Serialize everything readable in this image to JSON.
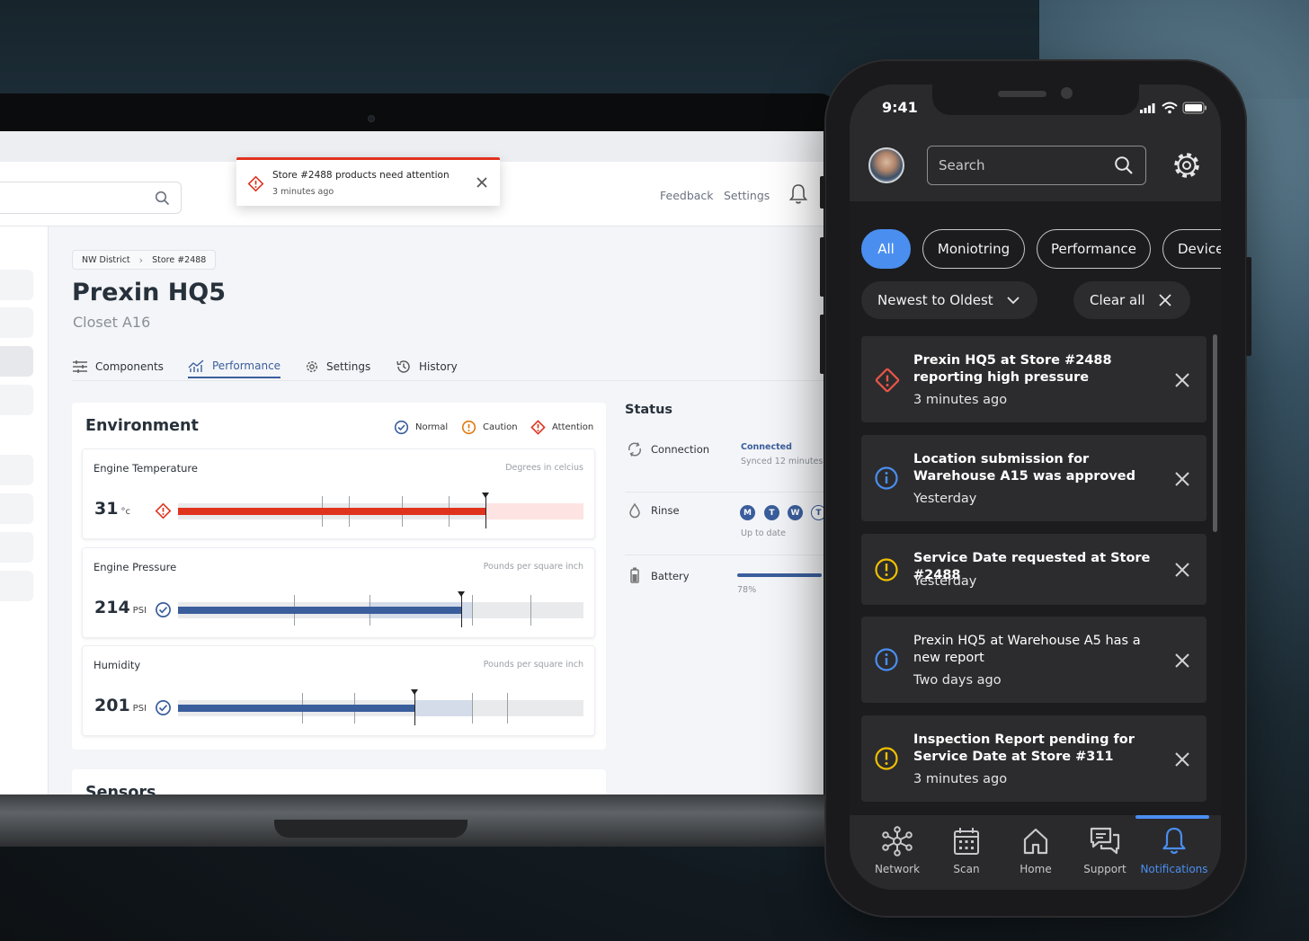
{
  "desktop": {
    "header": {
      "feedback": "Feedback",
      "settings": "Settings"
    },
    "toast": {
      "title": "Store #2488 products need attention",
      "time": "3 minutes ago"
    },
    "breadcrumb": [
      "NW District",
      "Store #2488"
    ],
    "page": {
      "title": "Prexin HQ5",
      "subtitle": "Closet A16"
    },
    "tabs": [
      {
        "label": "Components",
        "icon": "sliders-icon"
      },
      {
        "label": "Performance",
        "icon": "chart-icon",
        "active": true
      },
      {
        "label": "Settings",
        "icon": "gear-icon"
      },
      {
        "label": "History",
        "icon": "history-icon"
      }
    ],
    "environment": {
      "title": "Environment",
      "legend": [
        "Normal",
        "Caution",
        "Attention"
      ],
      "metrics": [
        {
          "name": "Engine Temperature",
          "unit_label": "Degrees in celcius",
          "value": "31",
          "suffix": "°c",
          "status": "attention",
          "fill_fraction": 0.758,
          "marker_fraction": 0.758,
          "range_bg_fraction": [
            0.758,
            1.0
          ]
        },
        {
          "name": "Engine Pressure",
          "unit_label": "Pounds per square inch",
          "value": "214",
          "suffix": "PSI",
          "status": "normal",
          "fill_fraction": 0.698,
          "marker_fraction": 0.698,
          "range_bg_fraction": [
            0.47,
            0.725
          ]
        },
        {
          "name": "Humidity",
          "unit_label": "Pounds per square inch",
          "value": "201",
          "suffix": "PSI",
          "status": "normal",
          "fill_fraction": 0.583,
          "marker_fraction": 0.583,
          "range_bg_fraction": [
            0.583,
            0.725
          ]
        }
      ]
    },
    "sensors": {
      "title": "Sensors"
    },
    "status": {
      "title": "Status",
      "connection": {
        "label": "Connection",
        "state": "Connected",
        "detail": "Synced 12 minutes"
      },
      "rinse": {
        "label": "Rinse",
        "days": [
          "M",
          "T",
          "W",
          "T"
        ],
        "detail": "Up to date"
      },
      "battery": {
        "label": "Battery",
        "percent_label": "78%",
        "fraction": 0.78
      }
    }
  },
  "phone": {
    "time": "9:41",
    "search_placeholder": "Search",
    "filters": [
      "All",
      "Moniotring",
      "Performance",
      "Device"
    ],
    "sort_label": "Newest to Oldest",
    "clear_label": "Clear all",
    "notifications": [
      {
        "kind": "attention",
        "title": "Prexin HQ5 at Store #2488 reporting high pressure",
        "time": "3 minutes ago",
        "bold": true
      },
      {
        "kind": "info",
        "title": "Location submission for Warehouse A15 was approved",
        "time": "Yesterday",
        "bold": true
      },
      {
        "kind": "caution",
        "title": "Service Date requested at Store #2488",
        "time": "Yesterday",
        "bold": true
      },
      {
        "kind": "info",
        "title": "Prexin HQ5 at Warehouse A5 has a new report",
        "time": "Two days ago",
        "bold": false
      },
      {
        "kind": "caution",
        "title": "Inspection Report pending for Service Date at Store #311",
        "time": "3 minutes ago",
        "bold": true
      }
    ],
    "nav": [
      {
        "label": "Network",
        "icon": "network-icon"
      },
      {
        "label": "Scan",
        "icon": "calendar-icon"
      },
      {
        "label": "Home",
        "icon": "home-icon"
      },
      {
        "label": "Support",
        "icon": "chat-icon"
      },
      {
        "label": "Notifications",
        "icon": "bell-icon",
        "active": true
      }
    ]
  },
  "colors": {
    "accent": "#3a5e9c",
    "attention": "#e0331e",
    "caution": "#f0b400",
    "info": "#4a8ef0"
  }
}
